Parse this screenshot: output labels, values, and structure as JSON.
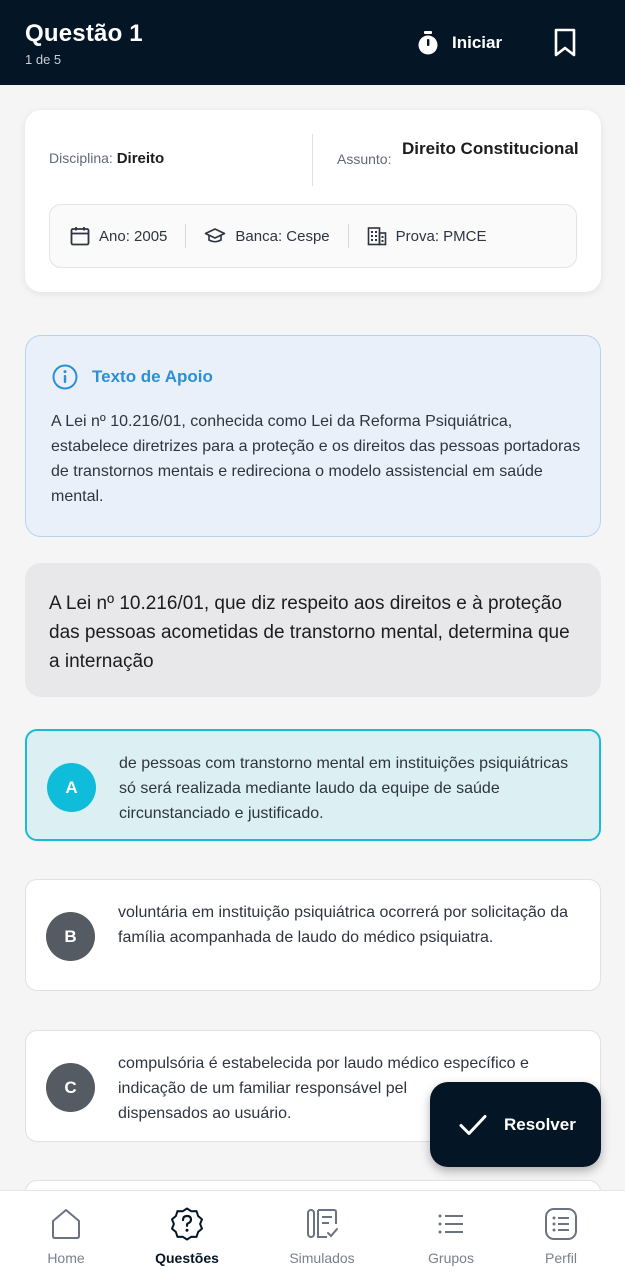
{
  "header": {
    "title": "Questão 1",
    "subtitle": "1 de 5",
    "start_label": "Iniciar"
  },
  "info": {
    "discipline_label": "Disciplina:",
    "discipline_value": "Direito",
    "subject_label": "Assunto:",
    "subject_value": "Direito Constitucional",
    "year": "Ano: 2005",
    "board": "Banca: Cespe",
    "exam": "Prova: PMCE"
  },
  "support": {
    "title": "Texto de Apoio",
    "text": "A Lei nº 10.216/01, conhecida como Lei da Reforma Psiquiátrica, estabelece diretrizes para a proteção e os direitos das pessoas portadoras de transtornos mentais e redireciona o modelo assistencial em saúde mental."
  },
  "question": {
    "text": "A Lei nº 10.216/01, que diz respeito aos direitos e à proteção das pessoas acometidas de transtorno mental, determina que a internação"
  },
  "options": [
    {
      "letter": "A",
      "text": "de pessoas com transtorno mental em instituições psiquiátricas só será realizada mediante laudo da equipe de saúde circunstanciado e justificado.",
      "selected": true
    },
    {
      "letter": "B",
      "text": "voluntária em instituição psiquiátrica ocorrerá por solicitação da família acompanhada de laudo do médico psiquiatra.",
      "selected": false
    },
    {
      "letter": "C",
      "text": "compulsória é estabelecida por laudo médico específico e indicação de um familiar responsável pe... dispensados ao usuário.",
      "text_visible_line1": "compulsória é estabelecida por laudo médico específico e",
      "text_visible_line2": "indicação de um familiar responsável pel",
      "text_visible_line3": "dispensados ao usuário.",
      "selected": false
    }
  ],
  "fab": {
    "label": "Resolver"
  },
  "nav": {
    "items": [
      {
        "label": "Home",
        "icon": "home-icon"
      },
      {
        "label": "Questões",
        "icon": "question-icon",
        "active": true
      },
      {
        "label": "Simulados",
        "icon": "simulados-icon"
      },
      {
        "label": "Grupos",
        "icon": "list-icon"
      },
      {
        "label": "Perfil",
        "icon": "profile-list-icon"
      }
    ]
  },
  "colors": {
    "header_bg": "#041526",
    "accent_cyan": "#0fbcd9",
    "support_blue": "#2d8fd4"
  }
}
